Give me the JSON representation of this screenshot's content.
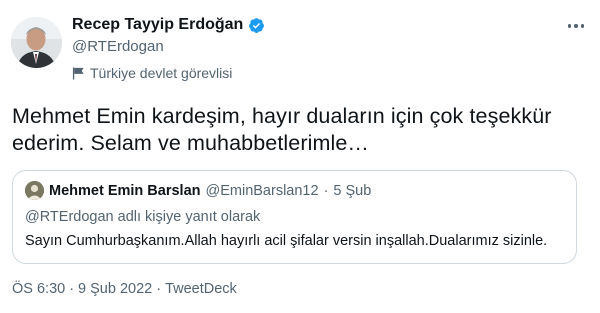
{
  "author": {
    "name": "Recep Tayyip Erdoğan",
    "handle": "@RTErdogan",
    "label": "Türkiye devlet görevlisi"
  },
  "tweet": {
    "text": "Mehmet Emin kardeşim, hayır duaların için çok teşekkür ederim. Selam ve muhabbetlerimle…"
  },
  "quoted_tweet": {
    "name": "Mehmet Emin Barslan",
    "handle": "@EminBarslan12",
    "separator": "·",
    "date": "5 Şub",
    "reply_context": "@RTErdogan adlı kişiye yanıt olarak",
    "text": "Sayın Cumhurbaşkanım.Allah hayırlı acil şifalar versin inşallah.Dualarımız sizinle."
  },
  "meta": {
    "time": "ÖS 6:30",
    "separator1": "·",
    "date": "9 Şub 2022",
    "separator2": "·",
    "source": "TweetDeck"
  },
  "colors": {
    "verified": "#1d9bf0",
    "secondary_text": "#536471",
    "border": "#cfd9de"
  },
  "icons": {
    "verified": "verified-badge-icon",
    "government": "flag-icon",
    "more": "more-options-icon"
  }
}
